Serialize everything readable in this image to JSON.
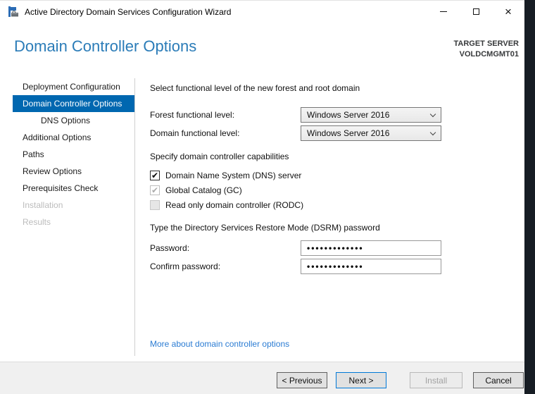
{
  "window": {
    "title": "Active Directory Domain Services Configuration Wizard"
  },
  "header": {
    "title": "Domain Controller Options",
    "target_server_label": "TARGET SERVER",
    "target_server_name": "VOLDCMGMT01"
  },
  "sidebar": {
    "items": [
      {
        "label": "Deployment Configuration",
        "state": "normal"
      },
      {
        "label": "Domain Controller Options",
        "state": "selected"
      },
      {
        "label": "DNS Options",
        "state": "normal",
        "indented": true
      },
      {
        "label": "Additional Options",
        "state": "normal"
      },
      {
        "label": "Paths",
        "state": "normal"
      },
      {
        "label": "Review Options",
        "state": "normal"
      },
      {
        "label": "Prerequisites Check",
        "state": "normal"
      },
      {
        "label": "Installation",
        "state": "disabled"
      },
      {
        "label": "Results",
        "state": "disabled"
      }
    ]
  },
  "content": {
    "functional_level_heading": "Select functional level of the new forest and root domain",
    "forest_label": "Forest functional level:",
    "forest_value": "Windows Server 2016",
    "domain_label": "Domain functional level:",
    "domain_value": "Windows Server 2016",
    "capabilities_heading": "Specify domain controller capabilities",
    "checkboxes": [
      {
        "label": "Domain Name System (DNS) server",
        "checked": true,
        "enabled": true
      },
      {
        "label": "Global Catalog (GC)",
        "checked": true,
        "enabled": false
      },
      {
        "label": "Read only domain controller (RODC)",
        "checked": false,
        "enabled": false
      }
    ],
    "dsrm_heading": "Type the Directory Services Restore Mode (DSRM) password",
    "password_label": "Password:",
    "password_value": "•••••••••••••",
    "confirm_label": "Confirm password:",
    "confirm_value": "•••••••••••••",
    "more_link": "More about domain controller options"
  },
  "footer": {
    "previous_label": "< Previous",
    "next_label": "Next >",
    "install_label": "Install",
    "cancel_label": "Cancel"
  },
  "icons": {
    "check_glyph": "✔",
    "close_glyph": "×"
  },
  "colors": {
    "sidebar_selected": "#0067b0",
    "header_title": "#2b7cb8",
    "link": "#2b7cd3",
    "default_button_border": "#0078d7",
    "footer_bg": "#f0f0f0"
  }
}
